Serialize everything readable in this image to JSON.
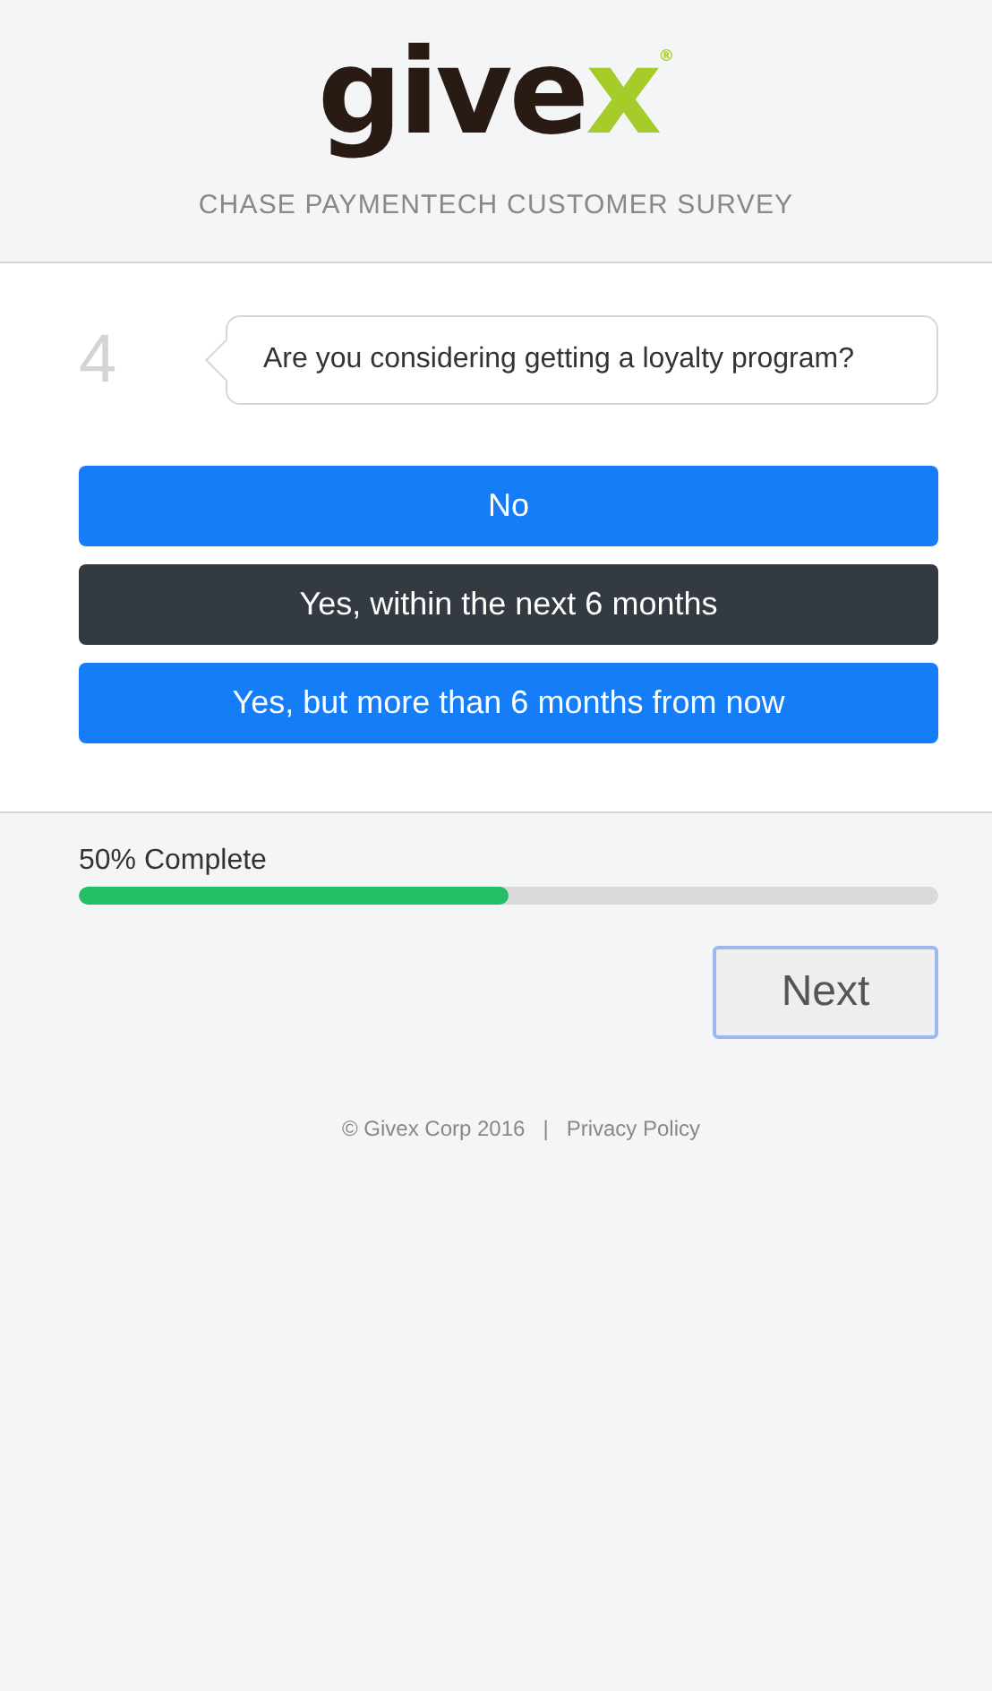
{
  "logo": {
    "word": "give",
    "accent": "x",
    "mark": "®"
  },
  "survey_title": "CHASE PAYMENTECH CUSTOMER SURVEY",
  "question": {
    "number": "4",
    "text": "Are you considering getting a loyalty program?"
  },
  "options": [
    {
      "label": "No",
      "selected": false
    },
    {
      "label": "Yes, within the next 6 months",
      "selected": true
    },
    {
      "label": "Yes, but more than 6 months from now",
      "selected": false
    }
  ],
  "progress": {
    "label": "50% Complete",
    "level": 0.5
  },
  "next_button": "Next",
  "footer": {
    "copyright": "© Givex Corp 2016",
    "separator": "|",
    "link": "Privacy Policy"
  }
}
